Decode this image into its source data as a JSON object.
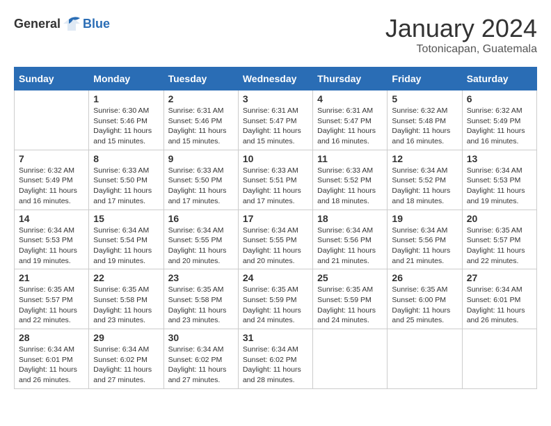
{
  "header": {
    "logo_general": "General",
    "logo_blue": "Blue",
    "month": "January 2024",
    "location": "Totonicapan, Guatemala"
  },
  "days": [
    "Sunday",
    "Monday",
    "Tuesday",
    "Wednesday",
    "Thursday",
    "Friday",
    "Saturday"
  ],
  "weeks": [
    [
      {
        "day": "",
        "sunrise": "",
        "sunset": "",
        "daylight": ""
      },
      {
        "day": "1",
        "sunrise": "Sunrise: 6:30 AM",
        "sunset": "Sunset: 5:46 PM",
        "daylight": "Daylight: 11 hours and 15 minutes."
      },
      {
        "day": "2",
        "sunrise": "Sunrise: 6:31 AM",
        "sunset": "Sunset: 5:46 PM",
        "daylight": "Daylight: 11 hours and 15 minutes."
      },
      {
        "day": "3",
        "sunrise": "Sunrise: 6:31 AM",
        "sunset": "Sunset: 5:47 PM",
        "daylight": "Daylight: 11 hours and 15 minutes."
      },
      {
        "day": "4",
        "sunrise": "Sunrise: 6:31 AM",
        "sunset": "Sunset: 5:47 PM",
        "daylight": "Daylight: 11 hours and 16 minutes."
      },
      {
        "day": "5",
        "sunrise": "Sunrise: 6:32 AM",
        "sunset": "Sunset: 5:48 PM",
        "daylight": "Daylight: 11 hours and 16 minutes."
      },
      {
        "day": "6",
        "sunrise": "Sunrise: 6:32 AM",
        "sunset": "Sunset: 5:49 PM",
        "daylight": "Daylight: 11 hours and 16 minutes."
      }
    ],
    [
      {
        "day": "7",
        "sunrise": "Sunrise: 6:32 AM",
        "sunset": "Sunset: 5:49 PM",
        "daylight": "Daylight: 11 hours and 16 minutes."
      },
      {
        "day": "8",
        "sunrise": "Sunrise: 6:33 AM",
        "sunset": "Sunset: 5:50 PM",
        "daylight": "Daylight: 11 hours and 17 minutes."
      },
      {
        "day": "9",
        "sunrise": "Sunrise: 6:33 AM",
        "sunset": "Sunset: 5:50 PM",
        "daylight": "Daylight: 11 hours and 17 minutes."
      },
      {
        "day": "10",
        "sunrise": "Sunrise: 6:33 AM",
        "sunset": "Sunset: 5:51 PM",
        "daylight": "Daylight: 11 hours and 17 minutes."
      },
      {
        "day": "11",
        "sunrise": "Sunrise: 6:33 AM",
        "sunset": "Sunset: 5:52 PM",
        "daylight": "Daylight: 11 hours and 18 minutes."
      },
      {
        "day": "12",
        "sunrise": "Sunrise: 6:34 AM",
        "sunset": "Sunset: 5:52 PM",
        "daylight": "Daylight: 11 hours and 18 minutes."
      },
      {
        "day": "13",
        "sunrise": "Sunrise: 6:34 AM",
        "sunset": "Sunset: 5:53 PM",
        "daylight": "Daylight: 11 hours and 19 minutes."
      }
    ],
    [
      {
        "day": "14",
        "sunrise": "Sunrise: 6:34 AM",
        "sunset": "Sunset: 5:53 PM",
        "daylight": "Daylight: 11 hours and 19 minutes."
      },
      {
        "day": "15",
        "sunrise": "Sunrise: 6:34 AM",
        "sunset": "Sunset: 5:54 PM",
        "daylight": "Daylight: 11 hours and 19 minutes."
      },
      {
        "day": "16",
        "sunrise": "Sunrise: 6:34 AM",
        "sunset": "Sunset: 5:55 PM",
        "daylight": "Daylight: 11 hours and 20 minutes."
      },
      {
        "day": "17",
        "sunrise": "Sunrise: 6:34 AM",
        "sunset": "Sunset: 5:55 PM",
        "daylight": "Daylight: 11 hours and 20 minutes."
      },
      {
        "day": "18",
        "sunrise": "Sunrise: 6:34 AM",
        "sunset": "Sunset: 5:56 PM",
        "daylight": "Daylight: 11 hours and 21 minutes."
      },
      {
        "day": "19",
        "sunrise": "Sunrise: 6:34 AM",
        "sunset": "Sunset: 5:56 PM",
        "daylight": "Daylight: 11 hours and 21 minutes."
      },
      {
        "day": "20",
        "sunrise": "Sunrise: 6:35 AM",
        "sunset": "Sunset: 5:57 PM",
        "daylight": "Daylight: 11 hours and 22 minutes."
      }
    ],
    [
      {
        "day": "21",
        "sunrise": "Sunrise: 6:35 AM",
        "sunset": "Sunset: 5:57 PM",
        "daylight": "Daylight: 11 hours and 22 minutes."
      },
      {
        "day": "22",
        "sunrise": "Sunrise: 6:35 AM",
        "sunset": "Sunset: 5:58 PM",
        "daylight": "Daylight: 11 hours and 23 minutes."
      },
      {
        "day": "23",
        "sunrise": "Sunrise: 6:35 AM",
        "sunset": "Sunset: 5:58 PM",
        "daylight": "Daylight: 11 hours and 23 minutes."
      },
      {
        "day": "24",
        "sunrise": "Sunrise: 6:35 AM",
        "sunset": "Sunset: 5:59 PM",
        "daylight": "Daylight: 11 hours and 24 minutes."
      },
      {
        "day": "25",
        "sunrise": "Sunrise: 6:35 AM",
        "sunset": "Sunset: 5:59 PM",
        "daylight": "Daylight: 11 hours and 24 minutes."
      },
      {
        "day": "26",
        "sunrise": "Sunrise: 6:35 AM",
        "sunset": "Sunset: 6:00 PM",
        "daylight": "Daylight: 11 hours and 25 minutes."
      },
      {
        "day": "27",
        "sunrise": "Sunrise: 6:34 AM",
        "sunset": "Sunset: 6:01 PM",
        "daylight": "Daylight: 11 hours and 26 minutes."
      }
    ],
    [
      {
        "day": "28",
        "sunrise": "Sunrise: 6:34 AM",
        "sunset": "Sunset: 6:01 PM",
        "daylight": "Daylight: 11 hours and 26 minutes."
      },
      {
        "day": "29",
        "sunrise": "Sunrise: 6:34 AM",
        "sunset": "Sunset: 6:02 PM",
        "daylight": "Daylight: 11 hours and 27 minutes."
      },
      {
        "day": "30",
        "sunrise": "Sunrise: 6:34 AM",
        "sunset": "Sunset: 6:02 PM",
        "daylight": "Daylight: 11 hours and 27 minutes."
      },
      {
        "day": "31",
        "sunrise": "Sunrise: 6:34 AM",
        "sunset": "Sunset: 6:02 PM",
        "daylight": "Daylight: 11 hours and 28 minutes."
      },
      {
        "day": "",
        "sunrise": "",
        "sunset": "",
        "daylight": ""
      },
      {
        "day": "",
        "sunrise": "",
        "sunset": "",
        "daylight": ""
      },
      {
        "day": "",
        "sunrise": "",
        "sunset": "",
        "daylight": ""
      }
    ]
  ]
}
